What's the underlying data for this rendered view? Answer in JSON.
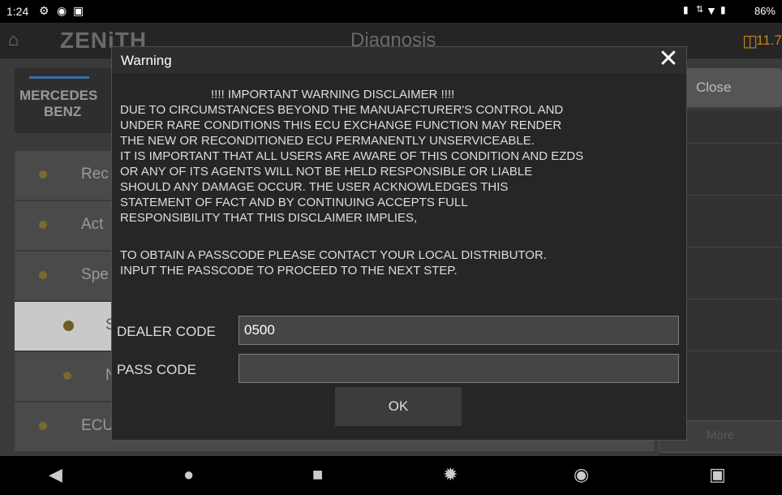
{
  "status_bar": {
    "time": "1:24",
    "right_text": "86%",
    "icons": [
      "settings-gear-icon",
      "location-icon",
      "screen-capture-icon",
      "vibrate-icon",
      "data-arrows-icon",
      "wifi-icon",
      "battery-icon"
    ]
  },
  "app": {
    "title": "Diagnosis",
    "logo": "ZENiTH",
    "voltage": "11.7",
    "brand_line1": "MERCEDES",
    "brand_line2": "BENZ",
    "close_label": "Close",
    "more_label": "More",
    "accent_color": "#c8801e"
  },
  "menu": [
    {
      "label": "Rec",
      "level": 0,
      "selected": false
    },
    {
      "label": "Act",
      "level": 0,
      "selected": false
    },
    {
      "label": "Spe",
      "level": 0,
      "selected": false
    },
    {
      "label": "S",
      "level": 1,
      "selected": true
    },
    {
      "label": "N",
      "level": 1,
      "selected": false
    },
    {
      "label": "ECU",
      "level": 0,
      "selected": false
    }
  ],
  "dialog": {
    "title": "Warning",
    "heading": "!!!! IMPORTANT WARNING DISCLAIMER !!!!",
    "lines": [
      "DUE TO CIRCUMSTANCES BEYOND THE MANUAFCTURER'S CONTROL AND",
      "UNDER RARE CONDITIONS THIS ECU EXCHANGE FUNCTION MAY RENDER",
      "THE NEW OR RECONDITIONED ECU PERMANENTLY UNSERVICEABLE.",
      "IT IS IMPORTANT THAT ALL USERS ARE AWARE OF THIS CONDITION AND EZDS",
      "OR ANY OF ITS AGENTS WILL NOT BE HELD RESPONSIBLE OR LIABLE",
      "SHOULD ANY DAMAGE OCCUR. THE USER ACKNOWLEDGES THIS",
      "STATEMENT OF FACT AND BY CONTINUING ACCEPTS FULL",
      "RESPONSIBILITY THAT THIS DISCLAIMER IMPLIES,",
      "TO OBTAIN A PASSCODE PLEASE CONTACT YOUR LOCAL DISTRIBUTOR.",
      "INPUT THE PASSCODE TO PROCEED TO THE NEXT STEP."
    ],
    "dealer_code_label": "DEALER CODE",
    "dealer_code_value": "0500",
    "pass_code_label": "PASS CODE",
    "pass_code_value": "",
    "ok_label": "OK"
  },
  "nav_bar": {
    "icons": [
      "back-icon",
      "home-icon",
      "recents-icon",
      "settings-icon",
      "chrome-icon",
      "screenshot-icon"
    ]
  }
}
